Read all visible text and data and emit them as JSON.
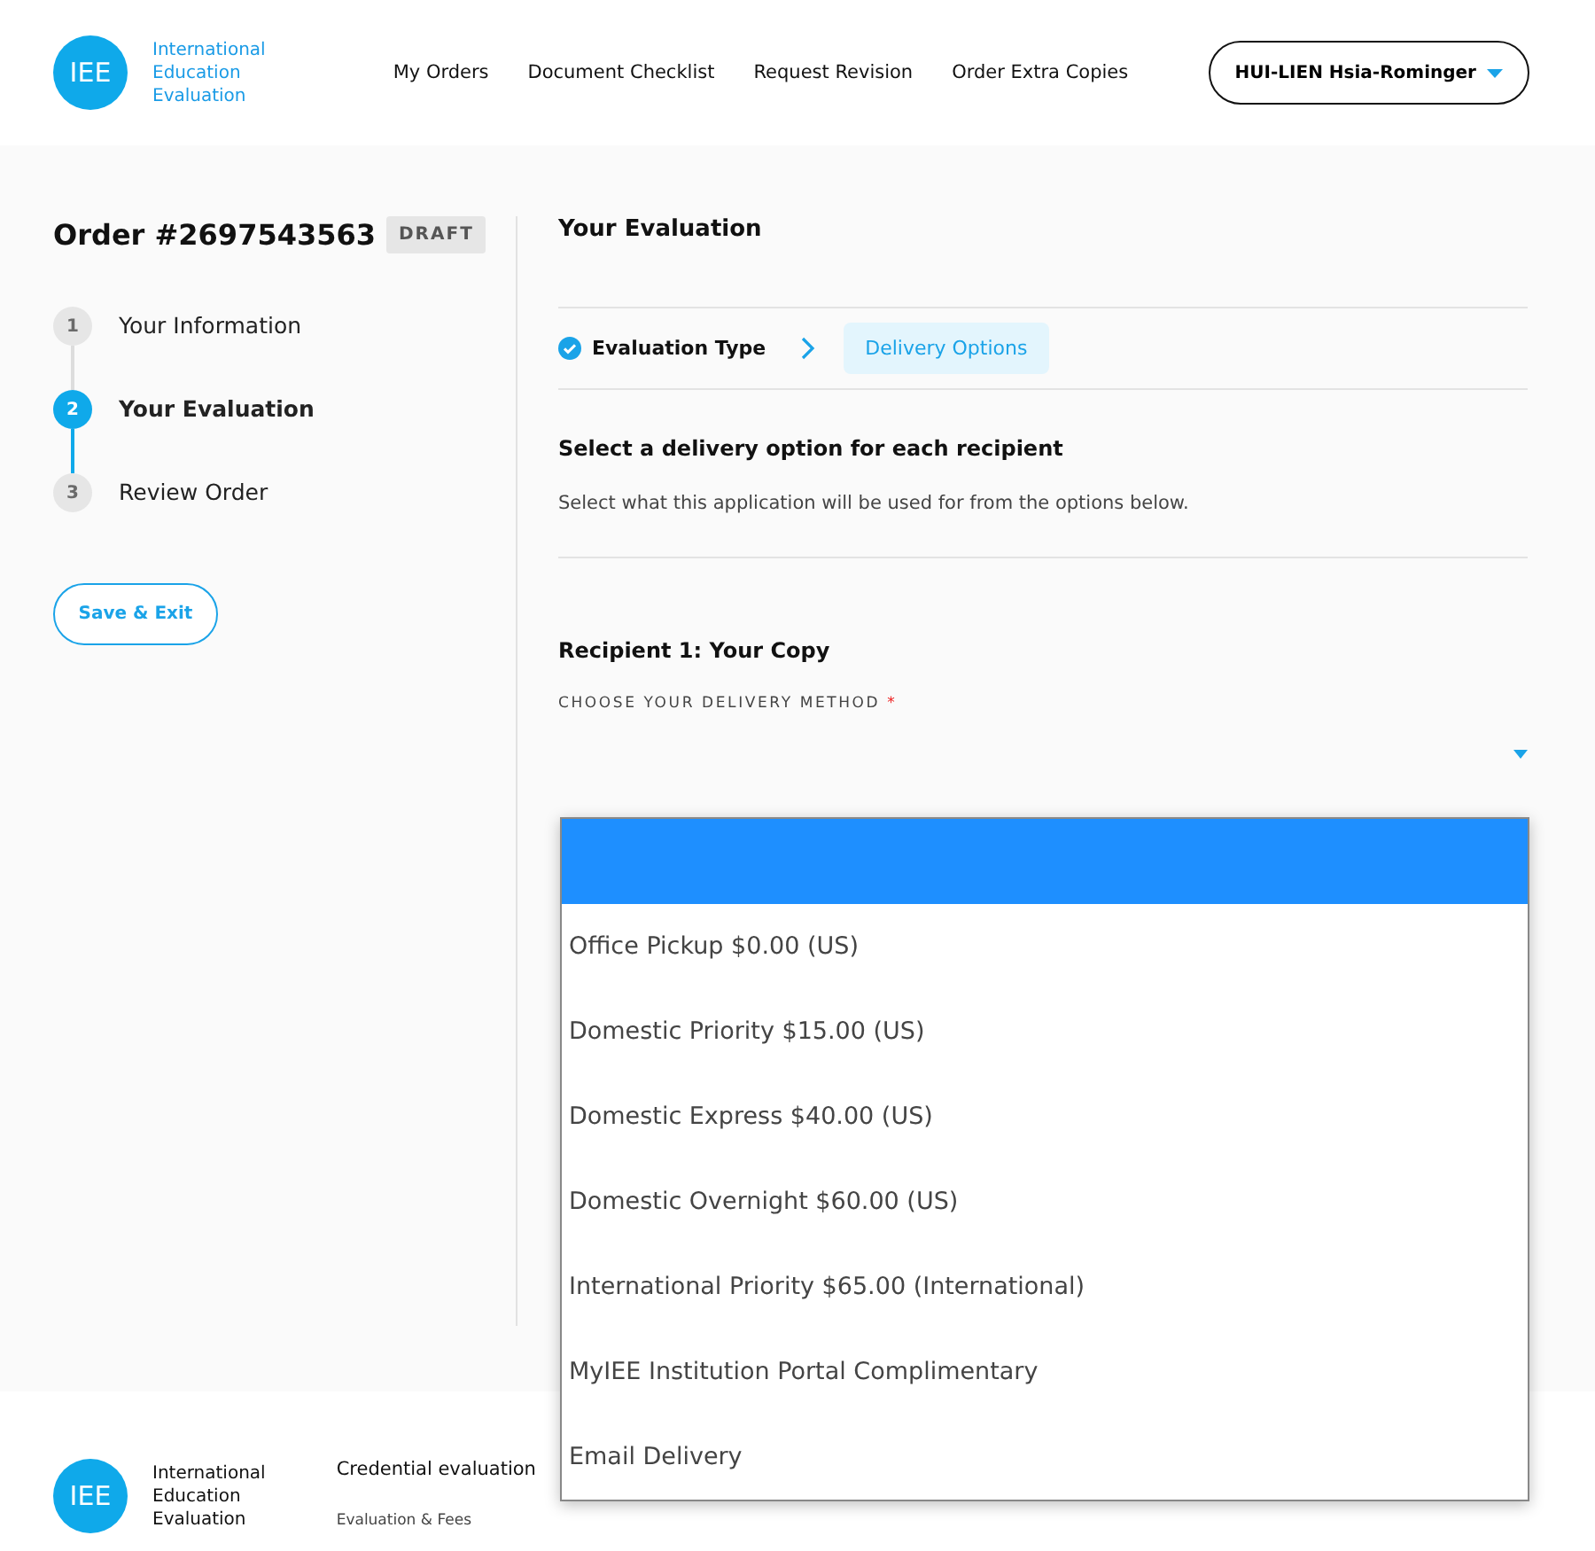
{
  "header": {
    "logo": {
      "mark": "IEE",
      "name_lines": [
        "International",
        "Education",
        "Evaluation"
      ]
    },
    "nav": [
      "My Orders",
      "Document Checklist",
      "Request Revision",
      "Order Extra Copies"
    ],
    "user_menu": "HUI-LIEN Hsia-Rominger"
  },
  "sidebar": {
    "order_title": "Order #2697543563",
    "status_badge": "DRAFT",
    "steps": [
      {
        "number": "1",
        "label": "Your Information",
        "selected": false
      },
      {
        "number": "2",
        "label": "Your Evaluation",
        "selected": true
      },
      {
        "number": "3",
        "label": "Review Order",
        "selected": false
      }
    ],
    "save_button": "Save & Exit"
  },
  "main": {
    "title": "Your Evaluation",
    "substeps": [
      {
        "label": "Evaluation Type",
        "kind": "done",
        "selected": false
      },
      {
        "label": "Delivery Options",
        "kind": "current",
        "selected": true
      }
    ],
    "section_title": "Select a delivery option for each recipient",
    "section_hint": "Select what this application will be used for from the options below.",
    "recipient_title": "Recipient 1: Your Copy",
    "field_label": "CHOOSE YOUR DELIVERY METHOD",
    "required_mark": "*",
    "dropdown_options": [
      {
        "selected": true
      },
      {
        "label": "Office Pickup $0.00 (US)",
        "selected": false
      },
      {
        "label": "Domestic Priority $15.00 (US)",
        "selected": false
      },
      {
        "label": "Domestic Express $40.00 (US)",
        "selected": false
      },
      {
        "label": "Domestic Overnight $60.00 (US)",
        "selected": false
      },
      {
        "label": "International Priority $65.00 (International)",
        "selected": false
      },
      {
        "label": "MyIEE Institution Portal Complimentary",
        "selected": false
      },
      {
        "label": "Email Delivery",
        "selected": false
      }
    ]
  },
  "footer": {
    "logo": {
      "mark": "IEE",
      "name_lines": [
        "International",
        "Education",
        "Evaluation"
      ]
    },
    "column_heading": "Credential evaluation",
    "link": "Evaluation & Fees"
  }
}
